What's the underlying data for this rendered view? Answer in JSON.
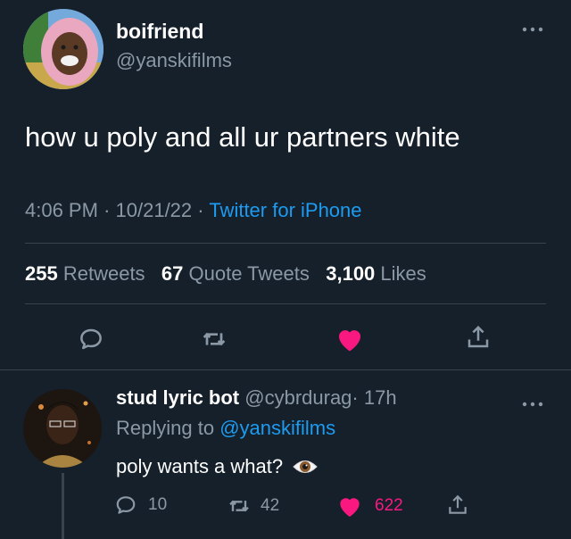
{
  "tweet": {
    "author": {
      "display_name": "boifriend",
      "handle": "@yanskifilms",
      "avatar": "avatar-pink-hood"
    },
    "text": "how u poly and all ur partners white",
    "time": "4:06 PM",
    "date": "10/21/22",
    "source": "Twitter for iPhone",
    "separator": "·",
    "stats": {
      "retweets_count": "255",
      "retweets_label": "Retweets",
      "quotes_count": "67",
      "quotes_label": "Quote Tweets",
      "likes_count": "3,100",
      "likes_label": "Likes"
    },
    "actions": [
      "reply-icon",
      "retweet-icon",
      "heart-icon",
      "share-icon"
    ],
    "liked": true
  },
  "reply": {
    "author": {
      "display_name": "stud lyric bot",
      "handle": "@cybrdurag",
      "age": "· 17h",
      "avatar": "avatar-dark-portrait"
    },
    "replying_to_prefix": "Replying to",
    "replying_to_handle": "@yanskifilms",
    "text": "poly wants a what?",
    "emoji": "eye-emoji",
    "counts": {
      "replies": "10",
      "retweets": "42",
      "likes": "622"
    },
    "liked": true
  },
  "colors": {
    "background": "#15202b",
    "text": "#ffffff",
    "muted": "#8b98a5",
    "accent": "#1d9bf0",
    "like": "#f91880",
    "divider": "#38444d"
  }
}
